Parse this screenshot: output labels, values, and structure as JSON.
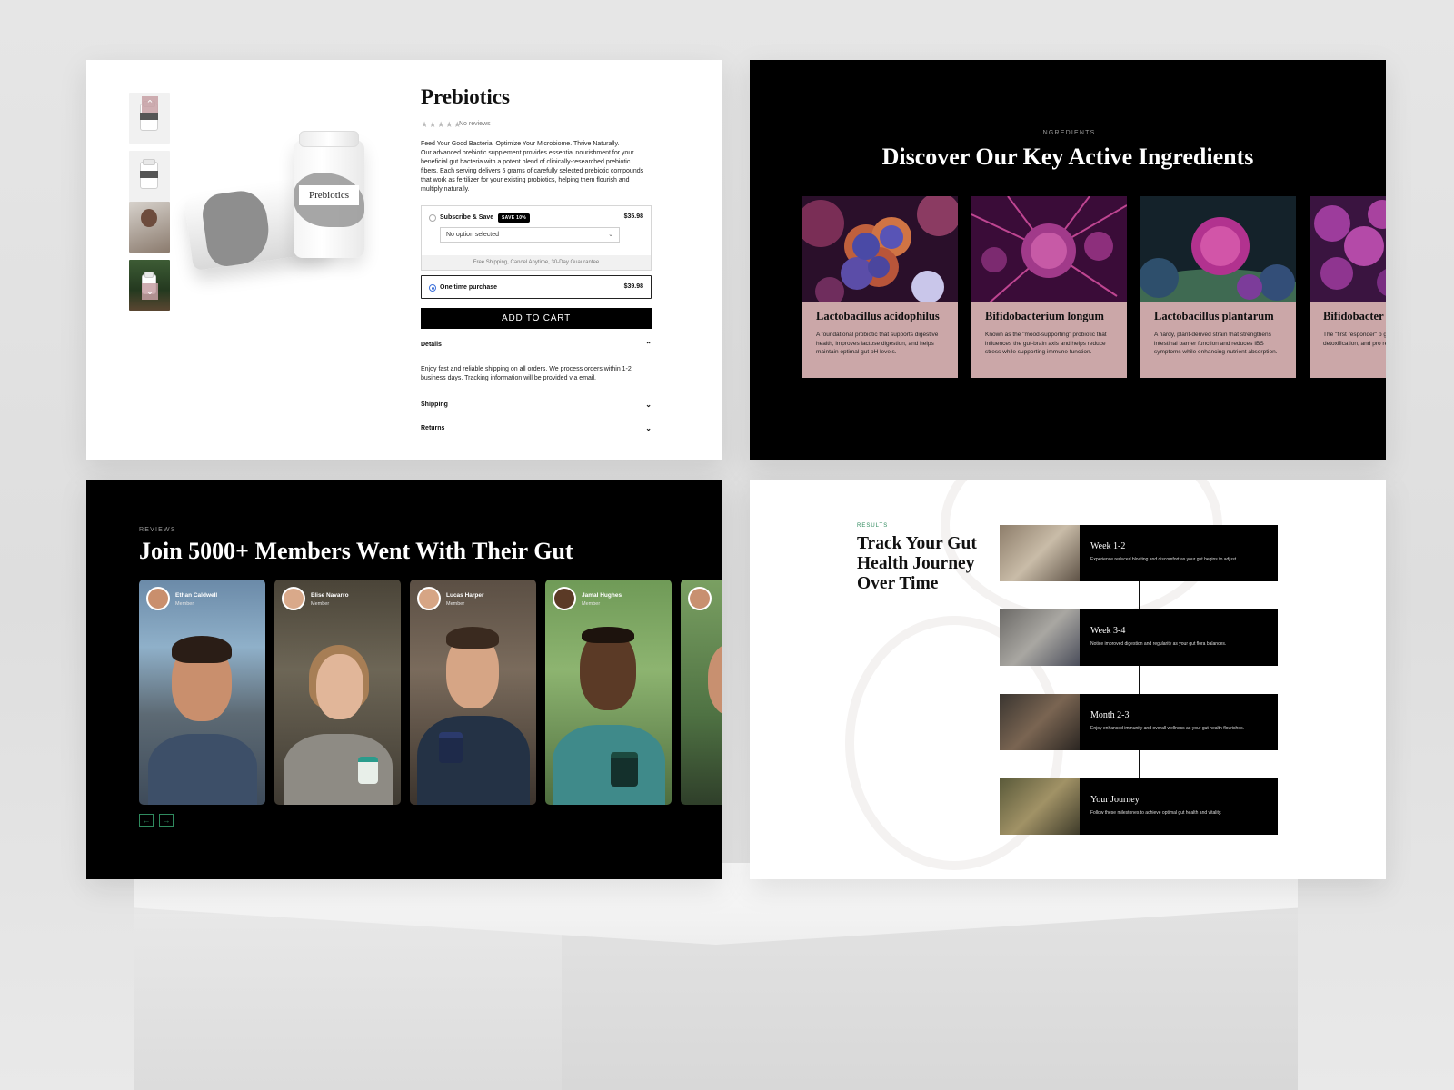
{
  "product": {
    "title": "Prebiotics",
    "stars": "★★★★★",
    "no_reviews": "No reviews",
    "bottle_label": "Prebiotics",
    "description": [
      "Feed Your Good Bacteria. Optimize Your Microbiome. Thrive Naturally.",
      "Our advanced prebiotic supplement provides essential nourishment for your beneficial gut bacteria with a potent blend of clinically-researched prebiotic fibers. Each serving delivers 5 grams of carefully selected prebiotic compounds that work as fertilizer for your existing probiotics, helping them flourish and multiply naturally."
    ],
    "thumb_prev_icon": "chevron-up-icon",
    "thumb_next_icon": "chevron-down-icon",
    "subscribe": {
      "label": "Subscribe & Save",
      "badge": "SAVE 10%",
      "price": "$35.98",
      "select_value": "No option selected",
      "footer": "Free Shipping, Cancel Anytime, 30-Day Guaurantee"
    },
    "one_time": {
      "label": "One time purchase",
      "price": "$39.98",
      "selected": true
    },
    "add_to_cart": "ADD TO CART",
    "accordion": [
      {
        "title": "Details",
        "expanded": true,
        "body": "Enjoy fast and reliable shipping on all orders. We process orders within 1-2 business days. Tracking information will be provided via email."
      },
      {
        "title": "Shipping",
        "expanded": false
      },
      {
        "title": "Returns",
        "expanded": false
      }
    ]
  },
  "ingredients": {
    "eyebrow": "INGREDIENTS",
    "title": "Discover Our Key Active Ingredients",
    "items": [
      {
        "name": "Lactobacillus acidophilus",
        "text": "A foundational probiotic that supports digestive health, improves lactose digestion, and helps maintain optimal gut pH levels."
      },
      {
        "name": "Bifidobacterium longum",
        "text": "Known as the \"mood-supporting\" probiotic that influences the gut-brain axis and helps reduce stress while supporting immune function."
      },
      {
        "name": "Lactobacillus plantarum",
        "text": "A hardy, plant-derived strain that strengthens intestinal barrier function and reduces IBS symptoms while enhancing nutrient absorption."
      },
      {
        "name": "Bifidobacter",
        "text": "The \"first responder\" p gut barrier integrity, su detoxification, and pro regularity."
      }
    ]
  },
  "reviews": {
    "eyebrow": "REVIEWS",
    "title": "Join 5000+ Members Went With Their Gut",
    "members": [
      {
        "name": "Ethan Caldwell",
        "role": "Member"
      },
      {
        "name": "Elise Navarro",
        "role": "Member"
      },
      {
        "name": "Lucas Harper",
        "role": "Member"
      },
      {
        "name": "Jamal Hughes",
        "role": "Member"
      },
      {
        "name": "",
        "role": ""
      }
    ],
    "prev_icon": "arrow-left-icon",
    "next_icon": "arrow-right-icon",
    "prev_glyph": "←",
    "next_glyph": "→"
  },
  "results": {
    "eyebrow": "RESULTS",
    "title": "Track Your Gut Health Journey Over Time",
    "timeline": [
      {
        "heading": "Week 1-2",
        "text": "Experience reduced bloating and discomfort as your gut begins to adjust."
      },
      {
        "heading": "Week 3-4",
        "text": "Notice improved digestion and regularity as your gut flora balances."
      },
      {
        "heading": "Month 2-3",
        "text": "Enjoy enhanced immunity and overall wellness as your gut health flourishes."
      },
      {
        "heading": "Your Journey",
        "text": "Follow these milestones to achieve optimal gut health and vitality."
      }
    ]
  },
  "colors": {
    "accent_pink": "#cba7a8",
    "accent_green": "#2f8a5e",
    "radio_blue": "#3b6fd9",
    "dark_bg": "#000000"
  }
}
